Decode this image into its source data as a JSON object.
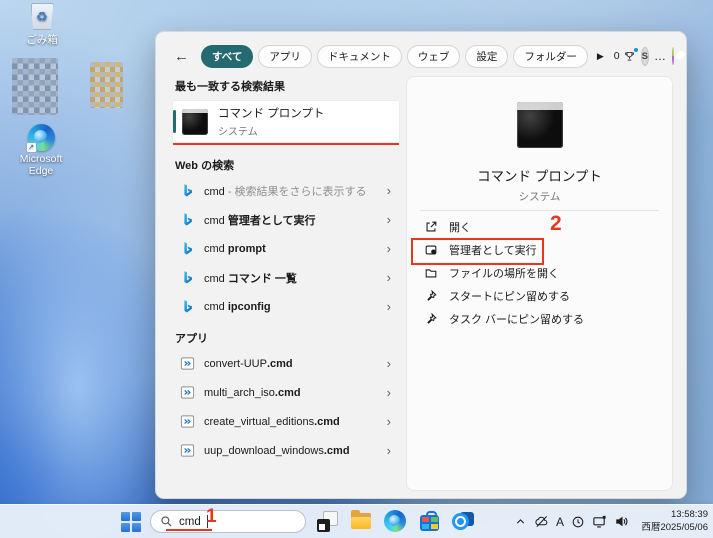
{
  "colors": {
    "accent_teal": "#256a70",
    "annotation_red": "#e8371f"
  },
  "annotations": {
    "one": "1",
    "two": "2"
  },
  "desktop": {
    "recycle_bin_label": "ごみ箱",
    "edge_label": "Microsoft Edge"
  },
  "panel": {
    "back_glyph": "←",
    "tabs": [
      "すべて",
      "アプリ",
      "ドキュメント",
      "ウェブ",
      "設定",
      "フォルダー"
    ],
    "more_tabs_glyph": "▶",
    "rewards_count": "0",
    "avatar_initial": "S",
    "more_glyph": "…",
    "best": {
      "header": "最も一致する検索結果",
      "title": "コマンド プロンプト",
      "subtitle": "システム"
    },
    "web": {
      "header": "Web の検索",
      "chevron": "›",
      "items": [
        {
          "prefix": "cmd",
          "suffix": " - 検索結果をさらに表示する"
        },
        {
          "prefix": "cmd ",
          "suffix": "管理者として実行"
        },
        {
          "prefix": "cmd ",
          "suffix": "prompt"
        },
        {
          "prefix": "cmd ",
          "suffix": "コマンド 一覧"
        },
        {
          "prefix": "cmd ",
          "suffix": "ipconfig"
        }
      ]
    },
    "apps": {
      "header": "アプリ",
      "items": [
        {
          "base": "convert-UUP",
          "ext": ".cmd"
        },
        {
          "base": "multi_arch_iso",
          "ext": ".cmd"
        },
        {
          "base": "create_virtual_editions",
          "ext": ".cmd"
        },
        {
          "base": "uup_download_windows",
          "ext": ".cmd"
        }
      ]
    },
    "detail": {
      "title": "コマンド プロンプト",
      "subtitle": "システム",
      "actions": [
        "開く",
        "管理者として実行",
        "ファイルの場所を開く",
        "スタートにピン留めする",
        "タスク バーにピン留めする"
      ]
    }
  },
  "taskbar": {
    "search_value": "cmd",
    "ime": "A",
    "time": "13:58:39",
    "date": "西暦2025/05/06"
  }
}
